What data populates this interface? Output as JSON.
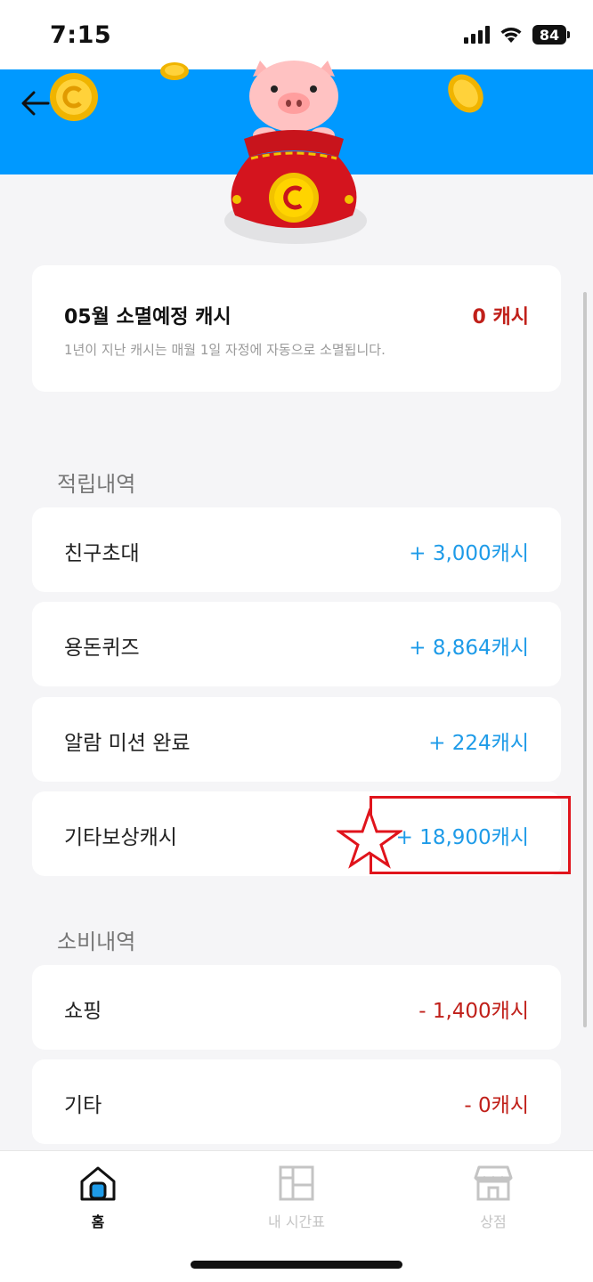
{
  "status_bar": {
    "time": "7:15",
    "battery": "84"
  },
  "expire": {
    "title": "05월 소멸예정 캐시",
    "amount": "0 캐시",
    "desc": "1년이 지난 캐시는 매월 1일 자정에 자동으로 소멸됩니다."
  },
  "earn": {
    "title": "적립내역",
    "items": [
      {
        "label": "친구초대",
        "value": "+ 3,000캐시"
      },
      {
        "label": "용돈퀴즈",
        "value": "+ 8,864캐시"
      },
      {
        "label": "알람 미션 완료",
        "value": "+ 224캐시"
      },
      {
        "label": "기타보상캐시",
        "value": "+ 18,900캐시"
      }
    ]
  },
  "spend": {
    "title": "소비내역",
    "items": [
      {
        "label": "쇼핑",
        "value": "- 1,400캐시"
      },
      {
        "label": "기타",
        "value": "- 0캐시"
      }
    ]
  },
  "tabs": [
    {
      "label": "홈",
      "icon": "home-icon"
    },
    {
      "label": "내 시간표",
      "icon": "timetable-icon"
    },
    {
      "label": "상점",
      "icon": "store-icon"
    }
  ],
  "colors": {
    "banner": "#0099ff",
    "plus": "#1e9be8",
    "minus": "#c0201a",
    "highlight": "#e0141c"
  }
}
